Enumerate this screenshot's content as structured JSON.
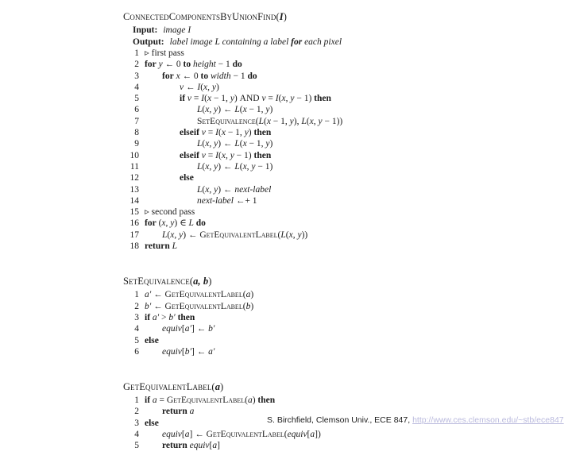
{
  "slide": {
    "background_color": "#ffffff",
    "text_color": "#1a1a1a"
  },
  "algorithms": [
    {
      "name": "ConnectedComponentsByUnionFind",
      "title_text": "ConnectedComponentsByUnionFind",
      "arg_text": "I",
      "paren_open": "(",
      "paren_close": ")",
      "io": [
        {
          "key": "Input:",
          "value": "image I"
        },
        {
          "key": "Output:",
          "value": "label image L containing a label for each pixel"
        }
      ],
      "lines": [
        {
          "n": "1",
          "indent": 0,
          "text": "▹ first pass"
        },
        {
          "n": "2",
          "indent": 0,
          "text": "for y ← 0 to height − 1 do"
        },
        {
          "n": "3",
          "indent": 1,
          "text": "for x ← 0 to width − 1 do"
        },
        {
          "n": "4",
          "indent": 2,
          "text": "v ← I(x, y)"
        },
        {
          "n": "5",
          "indent": 2,
          "text": "if v = I(x − 1, y) AND v = I(x, y − 1) then"
        },
        {
          "n": "6",
          "indent": 3,
          "text": "L(x, y) ← L(x − 1, y)"
        },
        {
          "n": "7",
          "indent": 3,
          "text": "SetEquivalence(L(x − 1, y), L(x, y − 1))"
        },
        {
          "n": "8",
          "indent": 2,
          "text": "elseif v = I(x − 1, y) then"
        },
        {
          "n": "9",
          "indent": 3,
          "text": "L(x, y) ← L(x − 1, y)"
        },
        {
          "n": "10",
          "indent": 2,
          "text": "elseif v = I(x, y − 1) then"
        },
        {
          "n": "11",
          "indent": 3,
          "text": "L(x, y) ← L(x, y − 1)"
        },
        {
          "n": "12",
          "indent": 2,
          "text": "else"
        },
        {
          "n": "13",
          "indent": 3,
          "text": "L(x, y) ← next-label"
        },
        {
          "n": "14",
          "indent": 3,
          "text": "next-label ←+ 1"
        },
        {
          "n": "15",
          "indent": 0,
          "text": "▹ second pass"
        },
        {
          "n": "16",
          "indent": 0,
          "text": "for (x, y) ∈ L do"
        },
        {
          "n": "17",
          "indent": 1,
          "text": "L(x, y) ← GetEquivalentLabel(L(x, y))"
        },
        {
          "n": "18",
          "indent": 0,
          "text": "return L"
        }
      ]
    },
    {
      "name": "SetEquivalence",
      "title_text": "SetEquivalence",
      "arg_text": "a, b",
      "paren_open": "(",
      "paren_close": ")",
      "io": [],
      "lines": [
        {
          "n": "1",
          "indent": 0,
          "text": "a′ ← GetEquivalentLabel(a)"
        },
        {
          "n": "2",
          "indent": 0,
          "text": "b′ ← GetEquivalentLabel(b)"
        },
        {
          "n": "3",
          "indent": 0,
          "text": "if a′ > b′ then"
        },
        {
          "n": "4",
          "indent": 1,
          "text": "equiv[a′] ← b′"
        },
        {
          "n": "5",
          "indent": 0,
          "text": "else"
        },
        {
          "n": "6",
          "indent": 1,
          "text": "equiv[b′] ← a′"
        }
      ]
    },
    {
      "name": "GetEquivalentLabel",
      "title_text": "GetEquivalentLabel",
      "arg_text": "a",
      "paren_open": "(",
      "paren_close": ")",
      "io": [],
      "lines": [
        {
          "n": "1",
          "indent": 0,
          "text": "if a = GetEquivalentLabel(a) then"
        },
        {
          "n": "2",
          "indent": 1,
          "text": "return a"
        },
        {
          "n": "3",
          "indent": 0,
          "text": "else"
        },
        {
          "n": "4",
          "indent": 1,
          "text": "equiv[a] ← GetEquivalentLabel(equiv[a])"
        },
        {
          "n": "5",
          "indent": 1,
          "text": "return equiv[a]"
        }
      ]
    }
  ],
  "footer": {
    "attribution": "S. Birchfield, Clemson Univ., ECE 847,",
    "url": "http://www.ces.clemson.edu/~stb/ece847",
    "url_color": "#b9b9dd"
  }
}
